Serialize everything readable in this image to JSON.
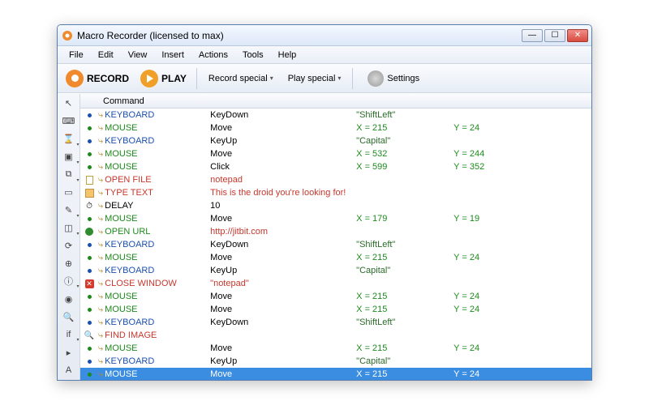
{
  "window": {
    "title": "Macro Recorder (licensed to max)"
  },
  "menu": [
    "File",
    "Edit",
    "View",
    "Insert",
    "Actions",
    "Tools",
    "Help"
  ],
  "toolbar": {
    "record": "RECORD",
    "play": "PLAY",
    "record_special": "Record special",
    "play_special": "Play special",
    "settings": "Settings"
  },
  "grid_header": "Command",
  "side_tools": [
    {
      "name": "cursor-icon",
      "glyph": "↖"
    },
    {
      "name": "keyboard-icon",
      "glyph": "⌨"
    },
    {
      "name": "hourglass-icon",
      "glyph": "⌛",
      "dd": true
    },
    {
      "name": "document-icon",
      "glyph": "▣",
      "dd": true
    },
    {
      "name": "copy-icon",
      "glyph": "⧉",
      "dd": true
    },
    {
      "name": "label-icon",
      "glyph": "▭"
    },
    {
      "name": "pencil-icon",
      "glyph": "✎",
      "dd": true
    },
    {
      "name": "window-icon",
      "glyph": "◫",
      "dd": true
    },
    {
      "name": "refresh-icon",
      "glyph": "⟳"
    },
    {
      "name": "globe-icon",
      "glyph": "⊕"
    },
    {
      "name": "info-icon",
      "glyph": "ⓘ",
      "dd": true
    },
    {
      "name": "world-icon",
      "glyph": "◉"
    },
    {
      "name": "search-icon",
      "glyph": "🔍"
    },
    {
      "name": "if-icon",
      "glyph": "if",
      "dd": true
    },
    {
      "name": "goto-icon",
      "glyph": "▸"
    },
    {
      "name": "text-icon",
      "glyph": "A"
    }
  ],
  "rows": [
    {
      "icon": "kb",
      "cmd": "KEYBOARD",
      "cmdc": "blue",
      "act": "KeyDown",
      "p1": "\"ShiftLeft\"",
      "p1c": "darkgreen"
    },
    {
      "icon": "ms",
      "cmd": "MOUSE",
      "cmdc": "green",
      "act": "Move",
      "p1": "X = 215",
      "p1c": "green",
      "p2": "Y = 24",
      "p2c": "green"
    },
    {
      "icon": "kb",
      "cmd": "KEYBOARD",
      "cmdc": "blue",
      "act": "KeyUp",
      "p1": "\"Capital\"",
      "p1c": "darkgreen"
    },
    {
      "icon": "ms",
      "cmd": "MOUSE",
      "cmdc": "green",
      "act": "Move",
      "p1": "X = 532",
      "p1c": "green",
      "p2": "Y = 244",
      "p2c": "green"
    },
    {
      "icon": "ms",
      "cmd": "MOUSE",
      "cmdc": "green",
      "act": "Click",
      "p1": "X = 599",
      "p1c": "green",
      "p2": "Y = 352",
      "p2c": "green"
    },
    {
      "icon": "of",
      "cmd": "OPEN FILE",
      "cmdc": "red",
      "act": "notepad",
      "actc": "red"
    },
    {
      "icon": "tt",
      "cmd": "TYPE TEXT",
      "cmdc": "red",
      "act": "This is the droid you're looking for!",
      "actc": "red"
    },
    {
      "icon": "dl",
      "cmd": "DELAY",
      "act": "10"
    },
    {
      "icon": "ms",
      "cmd": "MOUSE",
      "cmdc": "green",
      "act": "Move",
      "p1": "X = 179",
      "p1c": "green",
      "p2": "Y = 19",
      "p2c": "green"
    },
    {
      "icon": "ou",
      "cmd": "OPEN URL",
      "cmdc": "green",
      "act": "http://jitbit.com",
      "actc": "red"
    },
    {
      "icon": "kb",
      "cmd": "KEYBOARD",
      "cmdc": "blue",
      "act": "KeyDown",
      "p1": "\"ShiftLeft\"",
      "p1c": "darkgreen"
    },
    {
      "icon": "ms",
      "cmd": "MOUSE",
      "cmdc": "green",
      "act": "Move",
      "p1": "X = 215",
      "p1c": "green",
      "p2": "Y = 24",
      "p2c": "green"
    },
    {
      "icon": "kb",
      "cmd": "KEYBOARD",
      "cmdc": "blue",
      "act": "KeyUp",
      "p1": "\"Capital\"",
      "p1c": "darkgreen"
    },
    {
      "icon": "cw",
      "cmd": "CLOSE WINDOW",
      "cmdc": "red",
      "act": "\"notepad\"",
      "actc": "red"
    },
    {
      "icon": "ms",
      "cmd": "MOUSE",
      "cmdc": "green",
      "act": "Move",
      "p1": "X = 215",
      "p1c": "green",
      "p2": "Y = 24",
      "p2c": "green"
    },
    {
      "icon": "ms",
      "cmd": "MOUSE",
      "cmdc": "green",
      "act": "Move",
      "p1": "X = 215",
      "p1c": "green",
      "p2": "Y = 24",
      "p2c": "green"
    },
    {
      "icon": "kb",
      "cmd": "KEYBOARD",
      "cmdc": "blue",
      "act": "KeyDown",
      "p1": "\"ShiftLeft\"",
      "p1c": "darkgreen"
    },
    {
      "icon": "fi",
      "cmd": "FIND IMAGE",
      "cmdc": "red"
    },
    {
      "icon": "ms",
      "cmd": "MOUSE",
      "cmdc": "green",
      "act": "Move",
      "p1": "X = 215",
      "p1c": "green",
      "p2": "Y = 24",
      "p2c": "green"
    },
    {
      "icon": "kb",
      "cmd": "KEYBOARD",
      "cmdc": "blue",
      "act": "KeyUp",
      "p1": "\"Capital\"",
      "p1c": "darkgreen"
    },
    {
      "icon": "ms",
      "cmd": "MOUSE",
      "cmdc": "green",
      "act": "Move",
      "p1": "X = 215",
      "p1c": "green",
      "p2": "Y = 24",
      "p2c": "green",
      "sel": true
    }
  ]
}
